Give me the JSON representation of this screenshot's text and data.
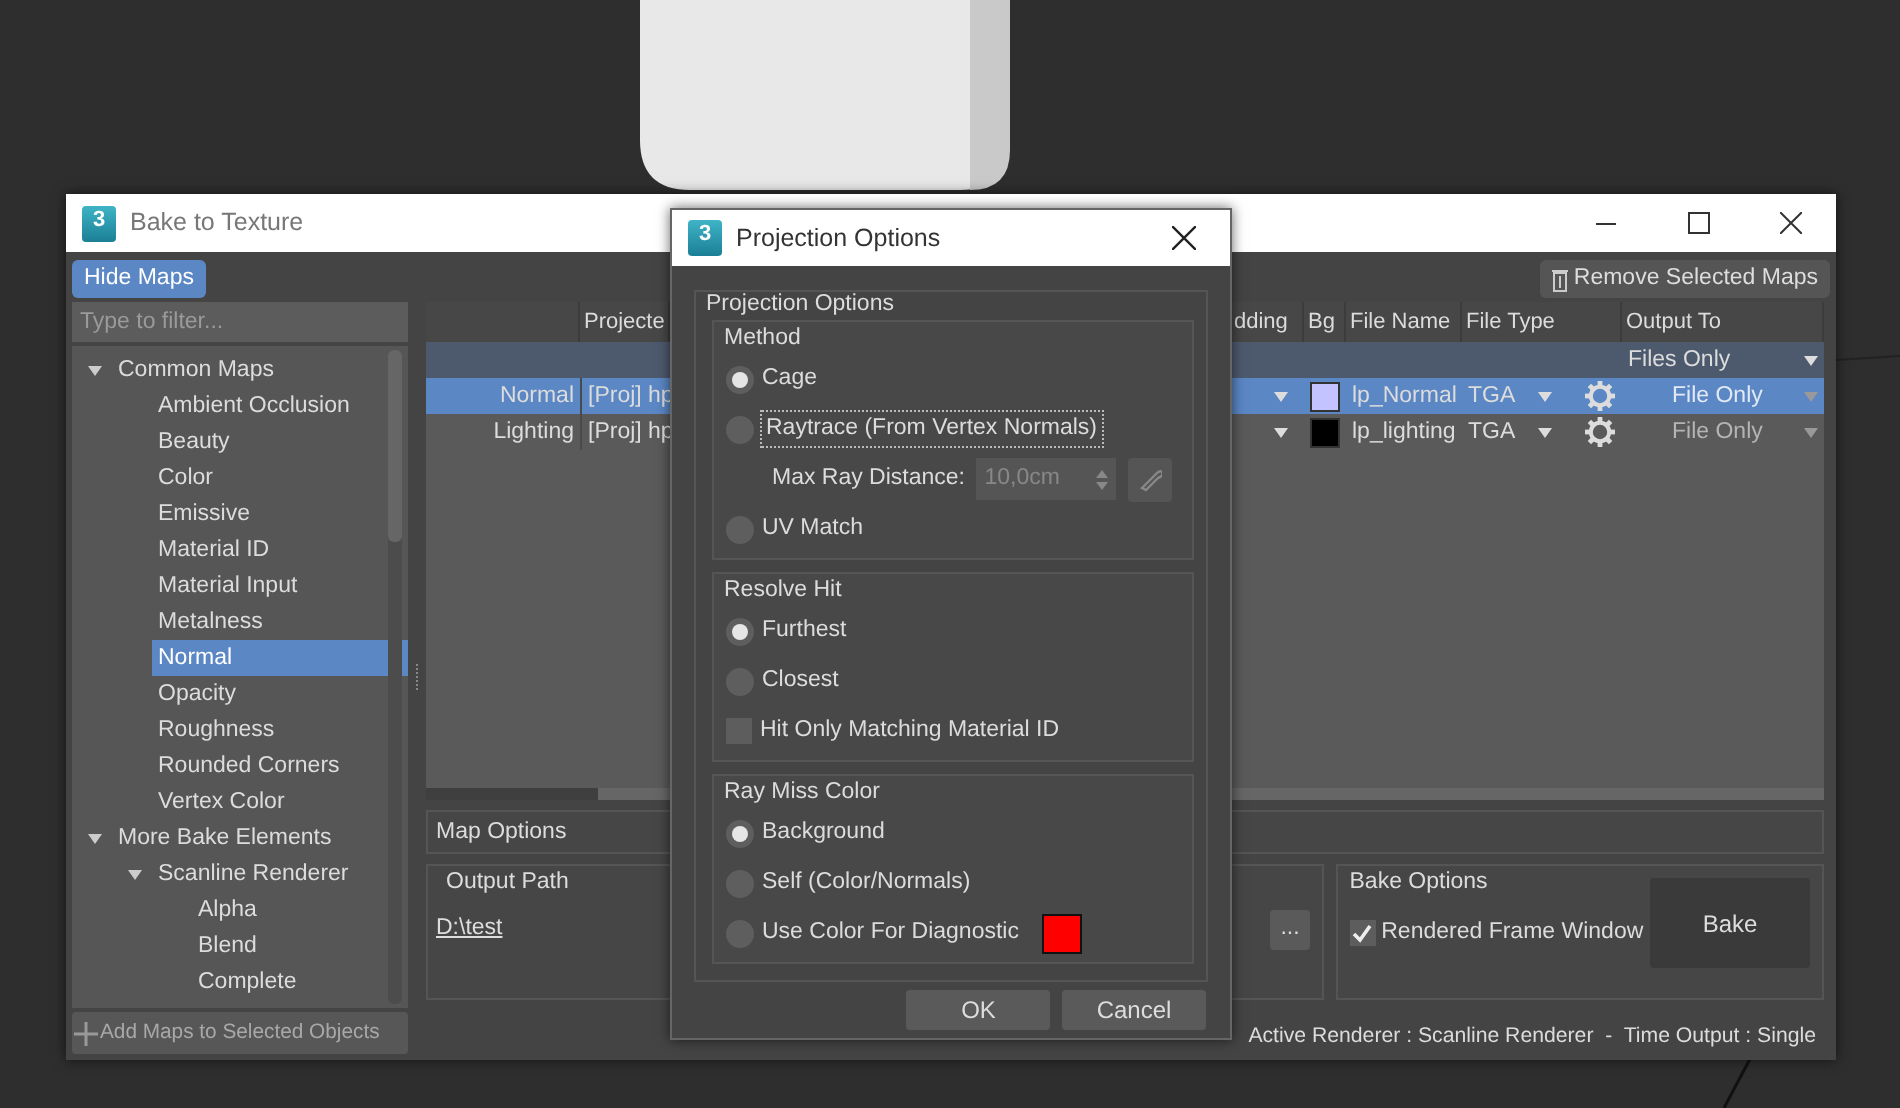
{
  "bake_window": {
    "logo": "3",
    "title": "Bake to Texture",
    "hide_maps_button": {
      "label": "Hide Maps",
      "active": true
    },
    "remove_button": "Remove Selected Maps",
    "filter": {
      "placeholder": "Type to filter..."
    },
    "tree": [
      {
        "label": "Common Maps",
        "expanded": true,
        "selected": false,
        "children": [
          {
            "label": "Ambient Occlusion",
            "selected": false
          },
          {
            "label": "Beauty",
            "selected": false
          },
          {
            "label": "Color",
            "selected": false
          },
          {
            "label": "Emissive",
            "selected": false
          },
          {
            "label": "Material ID",
            "selected": false
          },
          {
            "label": "Material Input",
            "selected": false
          },
          {
            "label": "Metalness",
            "selected": false
          },
          {
            "label": "Normal",
            "selected": true
          },
          {
            "label": "Opacity",
            "selected": false
          },
          {
            "label": "Roughness",
            "selected": false
          },
          {
            "label": "Rounded Corners",
            "selected": false
          },
          {
            "label": "Vertex Color",
            "selected": false
          }
        ]
      },
      {
        "label": "More Bake Elements",
        "expanded": true,
        "selected": false,
        "children": [
          {
            "label": "Scanline Renderer",
            "expanded": true,
            "selected": false,
            "children": [
              {
                "label": "Alpha",
                "selected": false
              },
              {
                "label": "Blend",
                "selected": false
              },
              {
                "label": "Complete",
                "selected": false
              }
            ]
          }
        ]
      }
    ],
    "add_maps_button": {
      "label": "Add Maps to Selected Objects",
      "disabled": true
    },
    "table": {
      "columns": [
        "Projecte",
        "dding",
        "Bg",
        "File Name",
        "File Type",
        "Output To"
      ],
      "group_row": {
        "output_to": "Files Only"
      },
      "rows": [
        {
          "name": "Normal",
          "projection": "[Proj] hp",
          "color": "#c3c3ff",
          "file_name": "lp_Normal",
          "file_type": "TGA",
          "output_to": "File Only",
          "output_disabled": true,
          "selected": true
        },
        {
          "name": "Lighting",
          "projection": "[Proj] hp",
          "color": "#000000",
          "file_name": "lp_lighting",
          "file_type": "TGA",
          "output_to": "File Only",
          "output_disabled": true,
          "selected": false
        }
      ]
    },
    "map_options": "Map Options",
    "output_path": {
      "title": "Output Path",
      "path": "D:\\test",
      "browse": "..."
    },
    "bake_options": {
      "title": "Bake Options",
      "rendered_frame_window": {
        "label": "Rendered Frame Window",
        "checked": true
      },
      "bake_button": "Bake"
    },
    "status_bar": "Active Renderer : Scanline Renderer  -  Time Output : Single"
  },
  "projection_dialog": {
    "logo": "3",
    "title": "Projection Options",
    "group_title": "Projection Options",
    "method": {
      "title": "Method",
      "options": [
        {
          "label": "Cage",
          "selected": true,
          "focused": false
        },
        {
          "label": "Raytrace  (From Vertex Normals)",
          "selected": false,
          "focused": true
        },
        {
          "label": "UV Match",
          "selected": false,
          "focused": false
        }
      ],
      "max_ray_distance": {
        "label": "Max Ray Distance:",
        "value": "10,0cm",
        "disabled": true
      }
    },
    "resolve_hit": {
      "title": "Resolve Hit",
      "options": [
        {
          "label": "Furthest",
          "selected": true
        },
        {
          "label": "Closest",
          "selected": false
        }
      ],
      "material_id_checkbox": {
        "label": "Hit Only Matching Material ID",
        "checked": false
      }
    },
    "ray_miss_color": {
      "title": "Ray Miss Color",
      "options": [
        {
          "label": "Background",
          "selected": true
        },
        {
          "label": "Self (Color/Normals)",
          "selected": false
        },
        {
          "label": "Use Color For Diagnostic",
          "selected": false
        }
      ],
      "diagnostic_swatch": {
        "color": "#ff0000"
      }
    },
    "buttons": [
      "OK",
      "Cancel"
    ]
  }
}
